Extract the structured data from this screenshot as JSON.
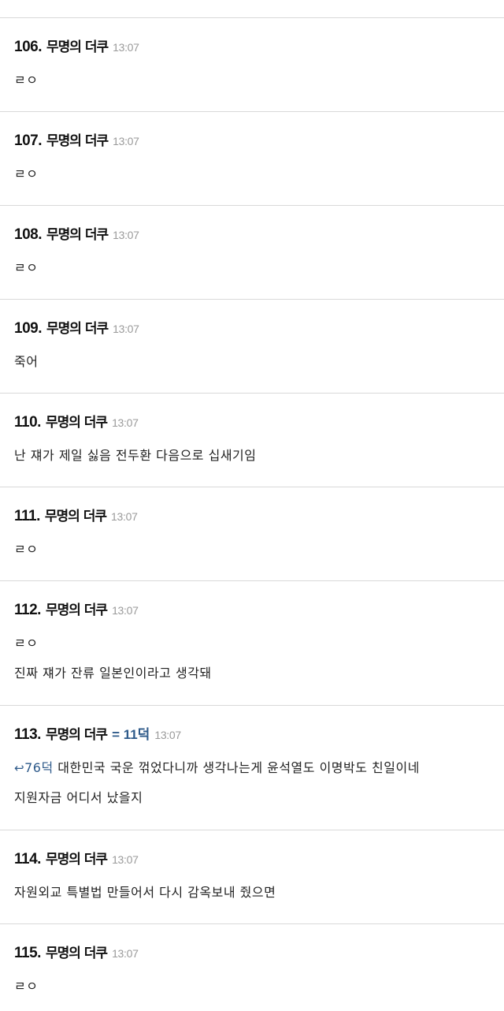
{
  "comments": [
    {
      "num": "106.",
      "name": "무명의 더쿠",
      "time": "13:07",
      "lines": [
        "ㄹㅇ"
      ]
    },
    {
      "num": "107.",
      "name": "무명의 더쿠",
      "time": "13:07",
      "lines": [
        "ㄹㅇ"
      ]
    },
    {
      "num": "108.",
      "name": "무명의 더쿠",
      "time": "13:07",
      "lines": [
        "ㄹㅇ"
      ]
    },
    {
      "num": "109.",
      "name": "무명의 더쿠",
      "time": "13:07",
      "lines": [
        "죽어"
      ]
    },
    {
      "num": "110.",
      "name": "무명의 더쿠",
      "time": "13:07",
      "lines": [
        "난 쟤가 제일 싫음 전두환 다음으로 십새기임"
      ]
    },
    {
      "num": "111.",
      "name": "무명의 더쿠",
      "time": "13:07",
      "lines": [
        "ㄹㅇ"
      ]
    },
    {
      "num": "112.",
      "name": "무명의 더쿠",
      "time": "13:07",
      "lines": [
        "ㄹㅇ",
        "진짜 쟤가 잔류 일본인이라고 생각돼"
      ]
    },
    {
      "num": "113.",
      "name": "무명의 더쿠",
      "alias": "= 11덕",
      "time": "13:07",
      "reply_icon": "reply-arrow-icon",
      "reply_ref": "76덕",
      "lines": [
        " 대한민국 국운 꺾었다니까 생각나는게 윤석열도 이명박도 친일이네",
        "지원자금 어디서 났을지"
      ]
    },
    {
      "num": "114.",
      "name": "무명의 더쿠",
      "time": "13:07",
      "lines": [
        "자원외교 특별법 만들어서 다시 감옥보내 줬으면"
      ]
    },
    {
      "num": "115.",
      "name": "무명의 더쿠",
      "time": "13:07",
      "lines": [
        "ㄹㅇ"
      ]
    }
  ],
  "colors": {
    "alias": "#2e5a8a",
    "time": "#9a9a9a",
    "divider": "#d9d9d9"
  }
}
